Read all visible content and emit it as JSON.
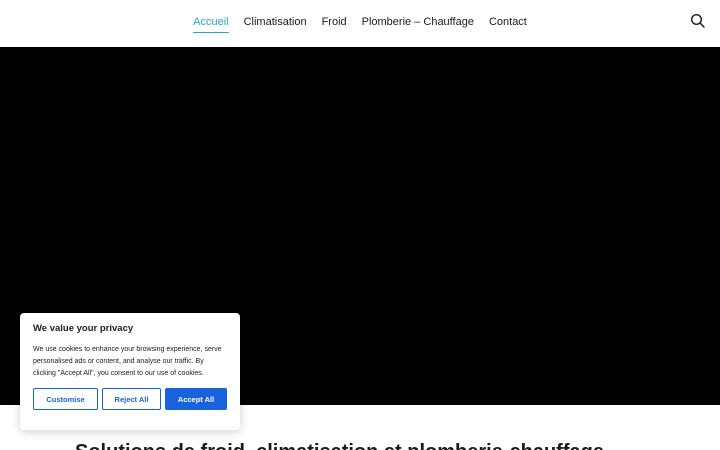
{
  "header": {
    "nav": [
      {
        "label": "Accueil",
        "active": true
      },
      {
        "label": "Climatisation",
        "active": false
      },
      {
        "label": "Froid",
        "active": false
      },
      {
        "label": "Plomberie – Chauffage",
        "active": false
      },
      {
        "label": "Contact",
        "active": false
      }
    ],
    "search_icon": "search-icon",
    "accent_color": "#2fa3c4"
  },
  "hero": {
    "background": "#000000"
  },
  "main": {
    "heading": "Solutions de froid, climatisation et plomberie-chauffage"
  },
  "cookie_banner": {
    "title": "We value your privacy",
    "text": "We use cookies to enhance your browsing experience, serve personalised ads or content, and analyse our traffic. By clicking \"Accept All\", you consent to our use of cookies.",
    "customise_label": "Customise",
    "reject_label": "Reject All",
    "accept_label": "Accept All",
    "button_color": "#1863dc"
  }
}
